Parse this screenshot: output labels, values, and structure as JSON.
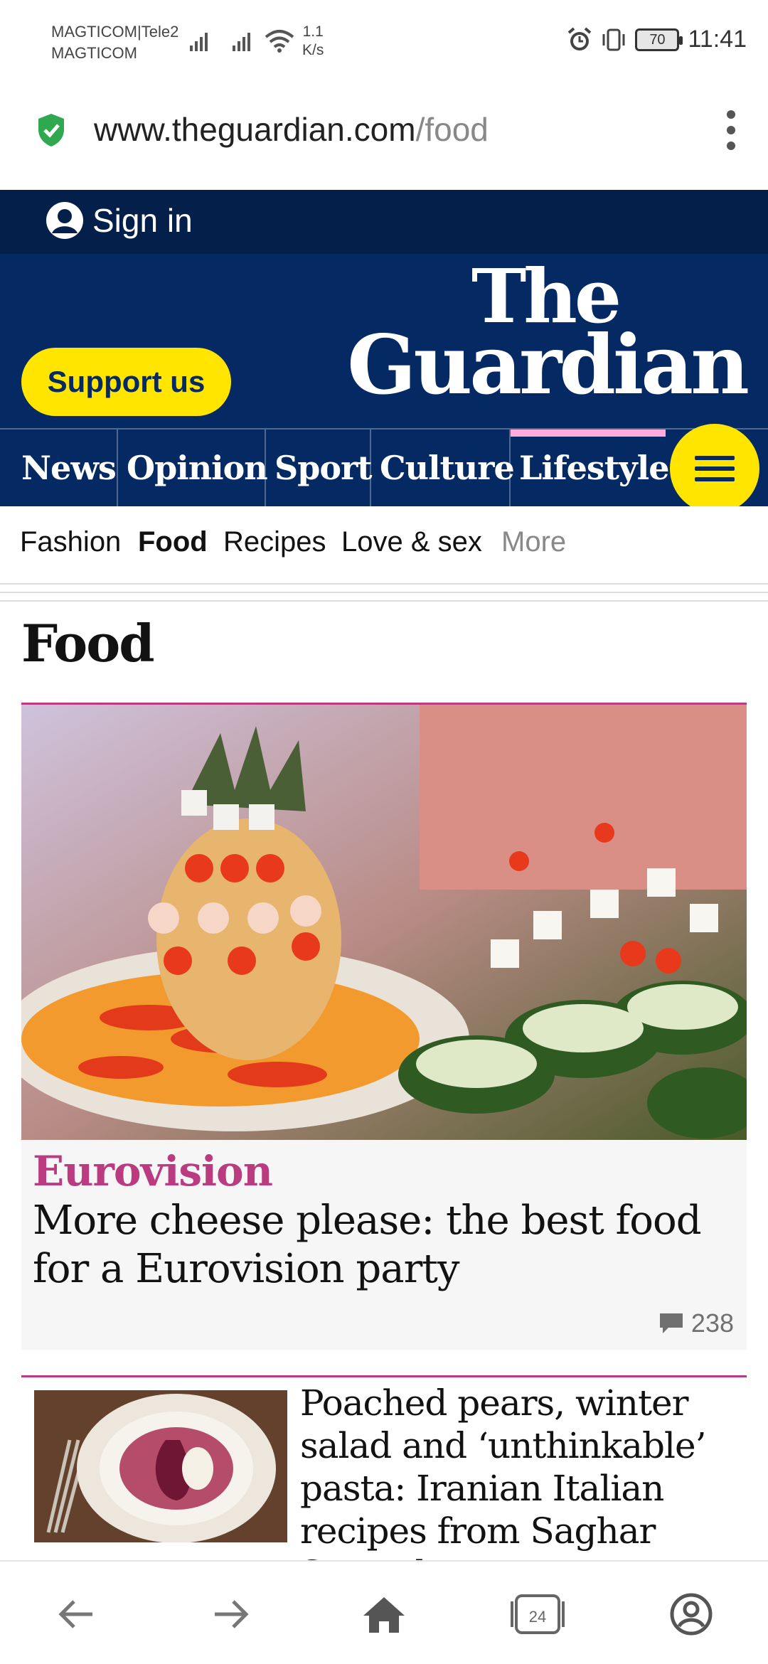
{
  "status_bar": {
    "carrier_1": "MAGTICOM|Tele2",
    "carrier_2": "MAGTICOM",
    "net_speed_value": "1.1",
    "net_speed_unit": "K/s",
    "battery": "70",
    "time": "11:41"
  },
  "browser": {
    "url_domain": "www.theguardian.com",
    "url_path": "/food",
    "tabs_count": "24",
    "icons": [
      "secure-shield-icon",
      "more-options-icon",
      "back-icon",
      "forward-icon",
      "home-icon",
      "tabs-icon",
      "account-icon"
    ]
  },
  "header": {
    "sign_in": "Sign in",
    "support_label": "Support us",
    "logo_line1": "The",
    "logo_line2": "Guardian",
    "brand_colors": {
      "navy": "#052962",
      "dark_navy": "#041f4a",
      "yellow": "#ffe500",
      "lifestyle_pink": "#ffabdb"
    }
  },
  "pillars": [
    "News",
    "Opinion",
    "Sport",
    "Culture",
    "Lifestyle"
  ],
  "active_pillar": "Lifestyle",
  "subnav": {
    "items": [
      "Fashion",
      "Food",
      "Recipes",
      "Love & sex"
    ],
    "more": "More",
    "active": "Food"
  },
  "page": {
    "title": "Food"
  },
  "feature": {
    "kicker": "Eurovision",
    "headline": "More cheese please: the best food for a Eurovision party",
    "comment_count": "238",
    "kicker_color": "#bb3b80"
  },
  "second_article": {
    "headline": "Poached pears, winter salad and ‘unthinkable’ pasta: Iranian Italian recipes from Saghar Setareh"
  }
}
